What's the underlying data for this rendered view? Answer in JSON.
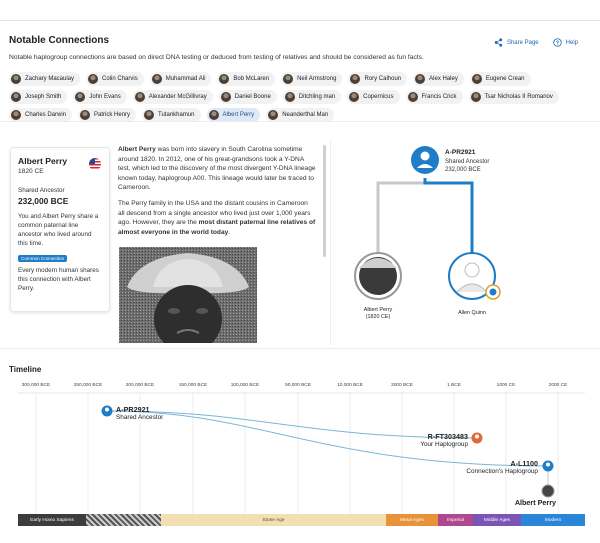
{
  "header": {
    "title": "Notable Connections",
    "share_label": "Share Page",
    "help_label": "Help",
    "subtitle": "Notable haplogroup connections are based on direct DNA testing or deduced from testing of relatives and should be considered as fun facts."
  },
  "people": [
    {
      "label": "Zachary Macaulay"
    },
    {
      "label": "Colin Charvis"
    },
    {
      "label": "Muhammad Ali"
    },
    {
      "label": "Bob McLaren"
    },
    {
      "label": "Neil Armstrong"
    },
    {
      "label": "Rory Calhoun"
    },
    {
      "label": "Alex Haley"
    },
    {
      "label": "Eugene Crean"
    },
    {
      "label": "Joseph Smith"
    },
    {
      "label": "John Evans"
    },
    {
      "label": "Alexander McGillivray"
    },
    {
      "label": "Daniel Boone"
    },
    {
      "label": "Ditchling man"
    },
    {
      "label": "Copernicus"
    },
    {
      "label": "Francis Crick"
    },
    {
      "label": "Tsar Nicholas II Romanov"
    },
    {
      "label": "Charles Darwin"
    },
    {
      "label": "Patrick Henry"
    },
    {
      "label": "Tutankhamun"
    },
    {
      "label": "Albert Perry",
      "selected": true
    },
    {
      "label": "Neanderthal Man"
    }
  ],
  "card": {
    "name": "Albert Perry",
    "year": "1820 CE",
    "shared_label": "Shared Ancestor",
    "shared_value": "232,000 BCE",
    "text": "You and Albert Perry share a common paternal line ancestor who lived around this time.",
    "badge": "Common Connection",
    "text2": "Every modern human shares this connection with Albert Perry."
  },
  "story": {
    "p1_name": "Albert Perry",
    "p1_rest": " was born into slavery in South Carolina sometime around 1820. In 2012, one of his great-grandsons took a Y-DNA test, which led to the discovery of the most divergent Y-DNA lineage known today, haplogroup A00. This lineage would later be traced to Cameroon.",
    "p2_start": "The Perry family in the USA and the distant cousins in Cameroon all descend from a single ancestor who lived just over 1,000 years ago. However, they are the ",
    "p2_bold": "most distant paternal line relatives of almost everyone in the world today",
    "p2_end": "."
  },
  "tree": {
    "ancestor_name": "A-PR2921",
    "ancestor_label": "Shared Ancestor",
    "ancestor_date": "232,000 BCE",
    "left_name": "Albert Perry",
    "left_date": "(1820 CE)",
    "right_name": "Allen Quinn"
  },
  "timeline": {
    "title": "Timeline",
    "ticks": [
      "300,000 BCE",
      "250,000 BCE",
      "200,000 BCE",
      "150,000 BCE",
      "100,000 BCE",
      "50,000 BCE",
      "10,000 BCE",
      "2000 BCE",
      "1 BCE",
      "1000 CE",
      "2000 CE"
    ],
    "ancestor_name": "A-PR2921",
    "ancestor_label": "Shared Ancestor",
    "your_name": "R-FT303483",
    "your_label": "Your Haplogroup",
    "conn_name": "A-L1100",
    "conn_label": "Connection's Haplogroup",
    "person_name": "Albert Perry",
    "eras": [
      {
        "label": "Early Homo Sapiens",
        "color": "#3c3c3c"
      },
      {
        "label": "",
        "color": "#555555"
      },
      {
        "label": "Stone Age",
        "color": "#f3dfb2"
      },
      {
        "label": "Metal Ages",
        "color": "#e8923a"
      },
      {
        "label": "Imperial",
        "color": "#b0488e"
      },
      {
        "label": "Middle Ages",
        "color": "#7a55b5"
      },
      {
        "label": "Modern",
        "color": "#2a86d6"
      }
    ]
  },
  "colors": {
    "accent": "#1f7cc7",
    "your_orange": "#e0693a",
    "line_blue": "#7bb6dc"
  }
}
